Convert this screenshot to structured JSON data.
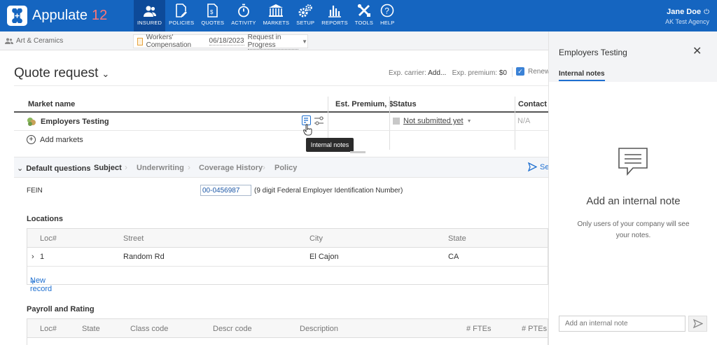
{
  "app": {
    "name": "Appulate",
    "version": "12"
  },
  "nav": [
    {
      "label": "INSURED",
      "icon": "people-icon"
    },
    {
      "label": "POLICIES",
      "icon": "document-edit-icon"
    },
    {
      "label": "QUOTES",
      "icon": "quote-doc-icon"
    },
    {
      "label": "ACTIVITY",
      "icon": "stopwatch-icon"
    },
    {
      "label": "MARKETS",
      "icon": "bank-icon"
    },
    {
      "label": "SETUP",
      "icon": "gears-icon"
    },
    {
      "label": "REPORTS",
      "icon": "bar-chart-icon"
    },
    {
      "label": "TOOLS",
      "icon": "tools-icon"
    },
    {
      "label": "HELP",
      "icon": "question-icon"
    }
  ],
  "user": {
    "name": "Jane Doe",
    "agency": "AK Test Agency"
  },
  "breadcrumb": {
    "insured": "Art & Ceramics"
  },
  "policy": {
    "type": "Workers' Compensation",
    "date": "06/18/2023",
    "status": "Request in Progress"
  },
  "page": {
    "title": "Quote request"
  },
  "exp": {
    "carrier_label": "Exp. carrier:",
    "carrier_value": "Add...",
    "premium_label": "Exp. premium:",
    "premium_value": "$0",
    "renew_label": "Renew"
  },
  "grid": {
    "headers": {
      "market": "Market name",
      "premium": "Est. Premium, $",
      "status": "Status",
      "contact": "Contact"
    },
    "row": {
      "market": "Employers Testing",
      "status": "Not submitted yet",
      "contact": "N/A"
    },
    "add_markets": "Add markets"
  },
  "tooltip": "Internal notes",
  "qtabs": {
    "default": "Default questions",
    "items": [
      "Subject",
      "Underwriting",
      "Coverage History",
      "Policy"
    ],
    "send": "Se"
  },
  "fein": {
    "label": "FEIN",
    "value": "00-0456987",
    "help": "(9 digit Federal Employer Identification Number)"
  },
  "locations": {
    "title": "Locations",
    "headers": [
      "Loc#",
      "Street",
      "City",
      "State"
    ],
    "rows": [
      {
        "loc": "1",
        "street": "Random Rd",
        "city": "El Cajon",
        "state": "CA"
      }
    ],
    "new_record": "New record"
  },
  "payroll": {
    "title": "Payroll and Rating",
    "headers": [
      "Loc#",
      "State",
      "Class code",
      "Descr code",
      "Description",
      "# FTEs",
      "# PTEs"
    ]
  },
  "panel": {
    "title": "Employers Testing",
    "tab": "Internal notes",
    "heading": "Add an internal note",
    "sub": "Only users of your company will see your notes.",
    "placeholder": "Add an internal note"
  }
}
